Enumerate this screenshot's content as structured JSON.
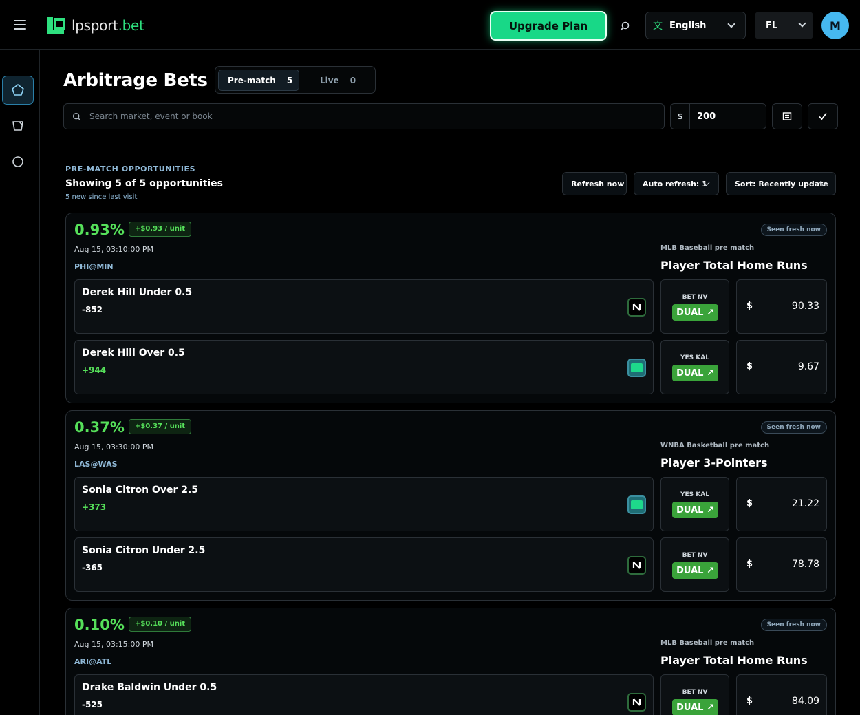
{
  "header": {
    "logo_text": "lpsport",
    "logo_tld": ".bet",
    "upgrade_label": "Upgrade Plan",
    "language": "English",
    "state": "FL",
    "avatar_initial": "M",
    "accent_color": "#18d887"
  },
  "sidebar": {
    "items": [
      {
        "icon": "tag-icon",
        "active": true
      },
      {
        "icon": "ticket-icon",
        "active": false
      },
      {
        "icon": "circle-icon",
        "active": false
      }
    ]
  },
  "page": {
    "title": "Arbitrage Bets",
    "tabs": [
      {
        "label": "Pre-match",
        "count": "5"
      },
      {
        "label": "Live",
        "count": "0"
      }
    ],
    "search_placeholder": "Search market, event or book",
    "stake_currency": "$",
    "stake_value": "200"
  },
  "section": {
    "label": "PRE-MATCH OPPORTUNITIES",
    "showing": "Showing 5 of 5 opportunities",
    "new_since": "5 new since last visit",
    "refresh_label": "Refresh now",
    "auto_refresh_label": "Auto refresh: 1",
    "sort_label": "Sort: Recently update"
  },
  "opportunities": [
    {
      "pct": "0.93%",
      "unit": "+$0.93 / unit",
      "time": "Aug 15, 03:10:00 PM",
      "game": "PHI@MIN",
      "seen": "Seen fresh now",
      "league": "MLB Baseball pre match",
      "market": "Player Total Home Runs",
      "legs": [
        {
          "name": "Derek Hill Under 0.5",
          "odds": "-852",
          "positive": false,
          "book_logo": "nv",
          "book": "BET NV",
          "action": "DUAL ↗",
          "currency": "$",
          "stake": "90.33"
        },
        {
          "name": "Derek Hill Over 0.5",
          "odds": "+944",
          "positive": true,
          "book_logo": "kal",
          "book": "YES KAL",
          "action": "DUAL ↗",
          "currency": "$",
          "stake": "9.67"
        }
      ]
    },
    {
      "pct": "0.37%",
      "unit": "+$0.37 / unit",
      "time": "Aug 15, 03:30:00 PM",
      "game": "LAS@WAS",
      "seen": "Seen fresh now",
      "league": "WNBA Basketball pre match",
      "market": "Player 3-Pointers",
      "legs": [
        {
          "name": "Sonia Citron Over 2.5",
          "odds": "+373",
          "positive": true,
          "book_logo": "kal",
          "book": "YES KAL",
          "action": "DUAL ↗",
          "currency": "$",
          "stake": "21.22"
        },
        {
          "name": "Sonia Citron Under 2.5",
          "odds": "-365",
          "positive": false,
          "book_logo": "nv",
          "book": "BET NV",
          "action": "DUAL ↗",
          "currency": "$",
          "stake": "78.78"
        }
      ]
    },
    {
      "pct": "0.10%",
      "unit": "+$0.10 / unit",
      "time": "Aug 15, 03:15:00 PM",
      "game": "ARI@ATL",
      "seen": "Seen fresh now",
      "league": "MLB Baseball pre match",
      "market": "Player Total Home Runs",
      "legs": [
        {
          "name": "Drake Baldwin Under 0.5",
          "odds": "-525",
          "positive": false,
          "book_logo": "nv",
          "book": "BET NV",
          "action": "DUAL ↗",
          "currency": "$",
          "stake": "84.09"
        }
      ]
    }
  ]
}
